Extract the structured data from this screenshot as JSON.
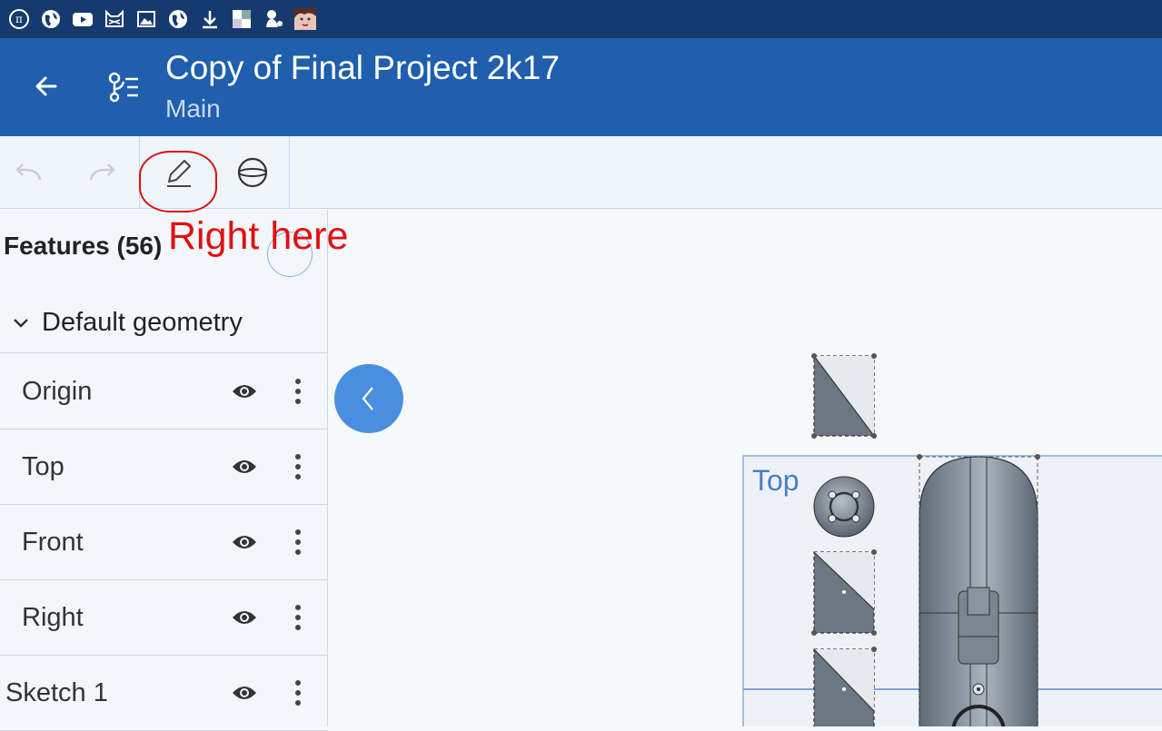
{
  "status_bar": {
    "icons": [
      "pi-icon",
      "globe-icon",
      "youtube-icon",
      "cat-icon",
      "image-icon",
      "globe-icon",
      "download-icon",
      "app-icon",
      "figure-icon",
      "avatar-icon"
    ]
  },
  "app_bar": {
    "title": "Copy of Final Project 2k17",
    "subtitle": "Main",
    "colors": {
      "background": "#1f5fad",
      "status": "#173a6e"
    }
  },
  "toolbar": {
    "undo_icon": "undo-icon",
    "redo_icon": "redo-icon",
    "sketch_icon": "pencil-icon",
    "plane_icon": "plane-icon"
  },
  "annotation": {
    "text": "Right here",
    "color": "#e01010"
  },
  "panel": {
    "header": "Features (56)",
    "group_label": "Default geometry",
    "features": [
      {
        "name": "Origin"
      },
      {
        "name": "Top"
      },
      {
        "name": "Front"
      },
      {
        "name": "Right"
      },
      {
        "name": "Sketch 1"
      }
    ]
  },
  "viewport": {
    "plane_label": "Top"
  }
}
